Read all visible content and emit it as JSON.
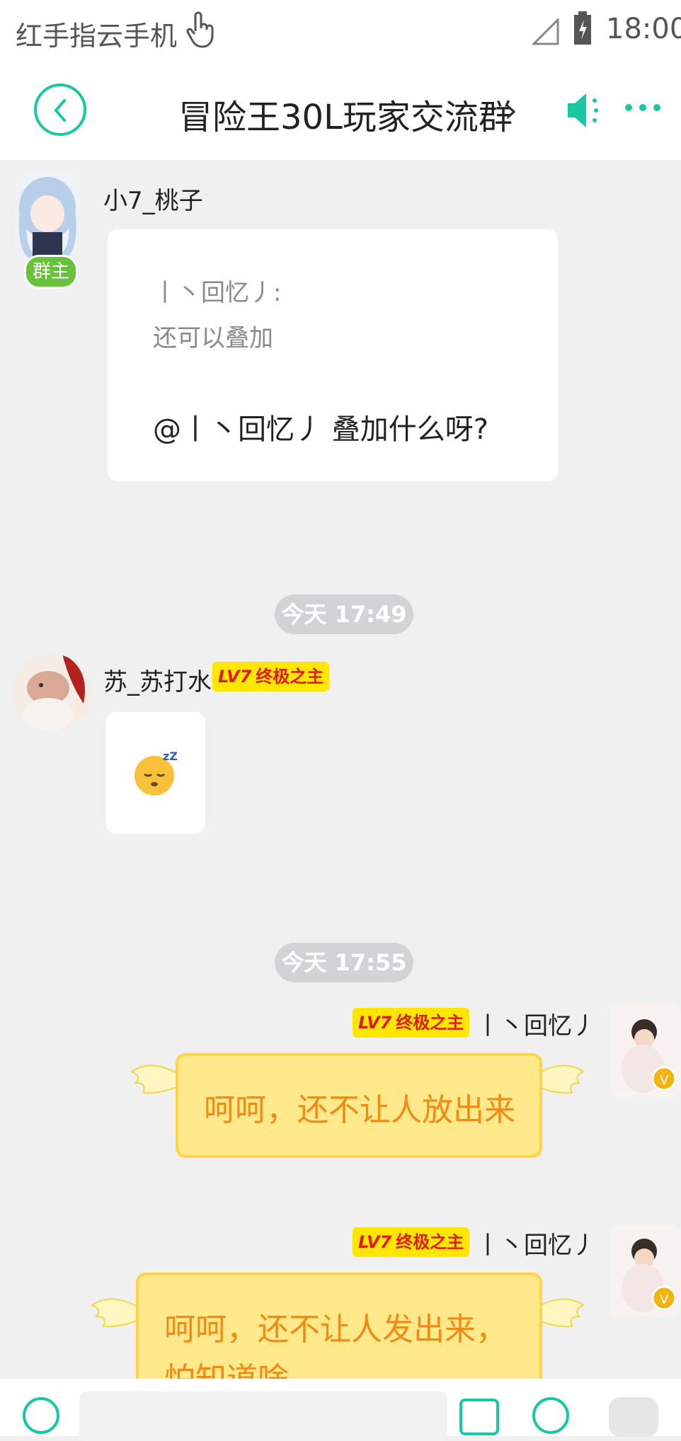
{
  "status_bar": {
    "app_name": "红手指云手机",
    "time": "18:00"
  },
  "header": {
    "title": "冒险王30L玩家交流群",
    "title_arrow": "›"
  },
  "messages": [
    {
      "sender": "小7_桃子",
      "role_tag": "群主",
      "quote_name": "丨丶回忆丿:",
      "quote_text": "还可以叠加",
      "text": "@丨丶回忆丿 叠加什么呀?"
    },
    {
      "timestamp": "今天 17:49"
    },
    {
      "sender": "苏_苏打水",
      "badge_level": "LV7",
      "badge_title": "终极之主",
      "content": "sleeping-face-emoji"
    },
    {
      "timestamp": "今天 17:55"
    },
    {
      "sender": "丨丶回忆丿",
      "badge_level": "LV7",
      "badge_title": "终极之主",
      "text": "呵呵，还不让人放出来"
    },
    {
      "sender": "丨丶回忆丿",
      "badge_level": "LV7",
      "badge_title": "终极之主",
      "text_line1": "呵呵，还不让人发出来，",
      "text_line2": "怕知道啥"
    }
  ],
  "colors": {
    "accent": "#19c8a0",
    "badge_bg": "#ffe600",
    "badge_text": "#e01b1b",
    "owner_tag": "#69c23c",
    "bubble_yellow": "#ffe98a",
    "bubble_text": "#f28a13"
  }
}
